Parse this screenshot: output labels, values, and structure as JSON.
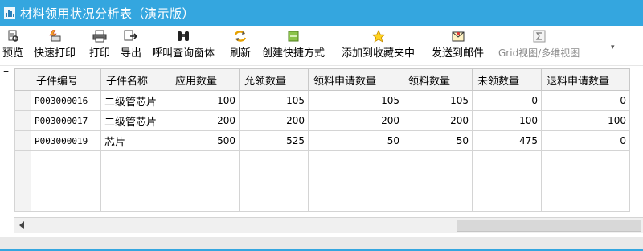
{
  "window": {
    "title": "材料领用状况分析表（演示版）"
  },
  "toolbar": {
    "items": [
      {
        "label": "预览",
        "icon": "preview-icon"
      },
      {
        "label": "快速打印",
        "icon": "quick-print-icon"
      },
      {
        "label": "打印",
        "icon": "printer-icon"
      },
      {
        "label": "导出",
        "icon": "export-icon"
      },
      {
        "label": "呼叫查询窗体",
        "icon": "binoculars-icon"
      },
      {
        "label": "刷新",
        "icon": "refresh-icon"
      },
      {
        "label": "创建快捷方式",
        "icon": "shortcut-icon"
      },
      {
        "label": "添加到收藏夹中",
        "icon": "star-icon"
      },
      {
        "label": "发送到邮件",
        "icon": "mail-icon"
      },
      {
        "label": "Grid视图/多维视图",
        "icon": "sigma-icon",
        "disabled": true
      }
    ],
    "overflow_glyph": "▾"
  },
  "grid": {
    "collapse_glyph": "−",
    "columns": [
      "子件编号",
      "子件名称",
      "应用数量",
      "允领数量",
      "领料申请数量",
      "领料数量",
      "未领数量",
      "退料申请数量"
    ],
    "rows": [
      [
        "P003000016",
        "二级管芯片",
        "100",
        "105",
        "105",
        "105",
        "0",
        "0"
      ],
      [
        "P003000017",
        "二级管芯片",
        "200",
        "200",
        "200",
        "200",
        "100",
        "100"
      ],
      [
        "P003000019",
        "芯片",
        "500",
        "525",
        "50",
        "50",
        "475",
        "0"
      ]
    ],
    "empty_rows": 3
  },
  "colors": {
    "titlebar": "#34a6df",
    "header_bg": "#f3f3f3"
  }
}
